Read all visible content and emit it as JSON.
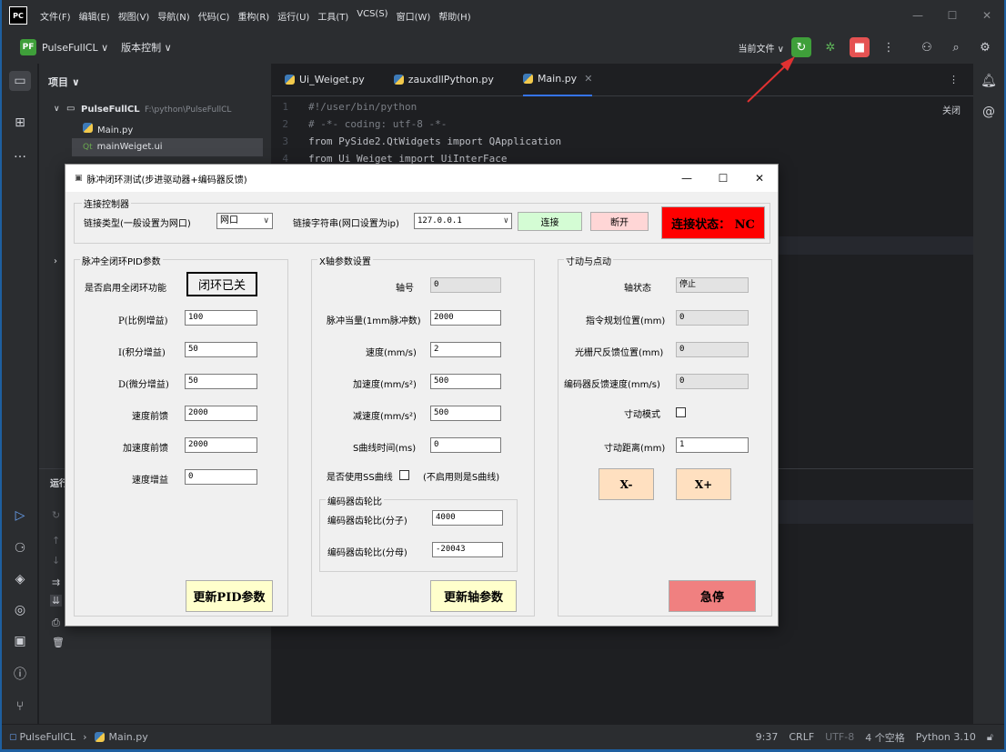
{
  "ide": {
    "menu": [
      "文件(F)",
      "编辑(E)",
      "视图(V)",
      "导航(N)",
      "代码(C)",
      "重构(R)",
      "运行(U)",
      "工具(T)",
      "VCS(S)",
      "窗口(W)",
      "帮助(H)"
    ],
    "logo": "PC",
    "project_badge": "PF",
    "project_name": "PulseFullCL ∨",
    "vcs": "版本控制 ∨",
    "run_config": "当前文件 ∨",
    "panel_title": "项目 ∨",
    "tree": {
      "root": "PulseFullCL",
      "root_path": "F:\\python\\PulseFullCL",
      "file1": "Main.py",
      "file2": "mainWeiget.ui"
    },
    "tabs": [
      "Ui_Weiget.py",
      "zauxdllPython.py",
      "Main.py"
    ],
    "close_hint": "关闭",
    "run_label": "运行",
    "code": [
      {
        "n": "1",
        "t": "#!/user/bin/python"
      },
      {
        "n": "2",
        "t": "# -*- coding: utf-8 -*-"
      },
      {
        "n": "3",
        "t": "from PySide2.QtWidgets import QApplication"
      },
      {
        "n": "4",
        "t": "from Ui_Weiget import UiInterFace"
      }
    ],
    "status": {
      "crumb_project": "PulseFullCL",
      "crumb_file": "Main.py",
      "pos": "9:37",
      "eol": "CRLF",
      "enc": "UTF-8",
      "indent": "4 个空格",
      "interp": "Python 3.10"
    }
  },
  "dialog": {
    "title": "脉冲闭环测试(步进驱动器+编码器反馈)",
    "conn": {
      "group": "连接控制器",
      "type_label": "链接类型(一般设置为网口)",
      "type_value": "网口",
      "str_label": "链接字符串(网口设置为ip)",
      "str_value": "127.0.0.1",
      "connect": "连接",
      "disconnect": "断开",
      "state": "连接状态： NC"
    },
    "pid": {
      "group": "脉冲全闭环PID参数",
      "enable_label": "是否启用全闭环功能",
      "enable_btn": "闭环已关",
      "p_label": "P(比例增益)",
      "p": "100",
      "i_label": "I(积分增益)",
      "i": "50",
      "d_label": "D(微分增益)",
      "d": "50",
      "vff_label": "速度前馈",
      "vff": "2000",
      "aff_label": "加速度前馈",
      "aff": "2000",
      "vg_label": "速度增益",
      "vg": "0",
      "update": "更新PID参数"
    },
    "axis": {
      "group": "X轴参数设置",
      "no_label": "轴号",
      "no": "0",
      "units_label": "脉冲当量(1mm脉冲数)",
      "units": "2000",
      "speed_label": "速度(mm/s)",
      "speed": "2",
      "accel_label": "加速度(mm/s²)",
      "accel": "500",
      "decel_label": "减速度(mm/s²)",
      "decel": "500",
      "s_label": "S曲线时间(ms)",
      "s": "0",
      "ss_label": "是否使用SS曲线",
      "ss_hint": "(不启用则是S曲线)",
      "gear_group": "编码器齿轮比",
      "num_label": "编码器齿轮比(分子)",
      "num": "4000",
      "den_label": "编码器齿轮比(分母)",
      "den": "-20043",
      "update": "更新轴参数"
    },
    "jog": {
      "group": "寸动与点动",
      "state_label": "轴状态",
      "state": "停止",
      "dpos_label": "指令规划位置(mm)",
      "dpos": "0",
      "enc_label": "光栅尺反馈位置(mm)",
      "enc": "0",
      "espeed_label": "编码器反馈速度(mm/s)",
      "espeed": "0",
      "mode_label": "寸动模式",
      "dist_label": "寸动距离(mm)",
      "dist": "1",
      "minus": "X-",
      "plus": "X+",
      "stop": "急停"
    }
  }
}
